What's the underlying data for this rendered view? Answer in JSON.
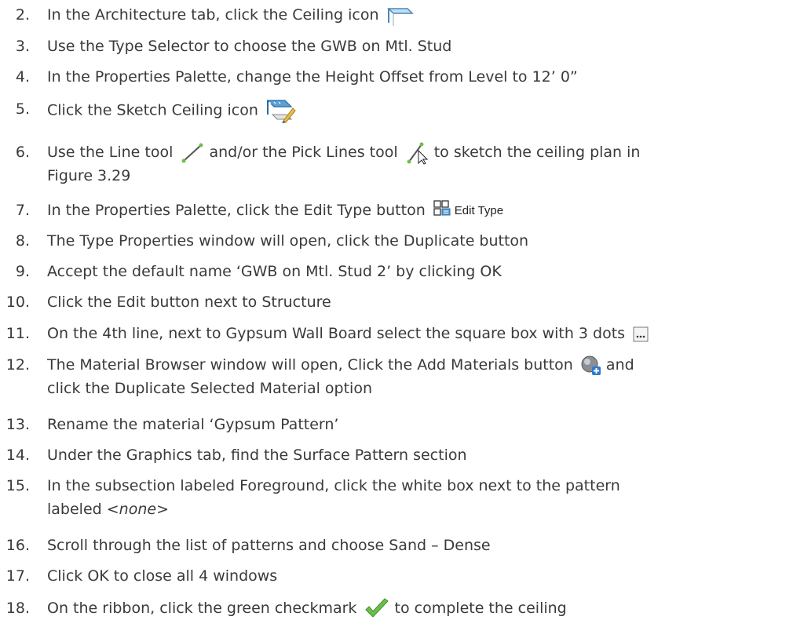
{
  "steps": [
    {
      "num": "2.",
      "text": "In the Architecture tab, click the Ceiling icon",
      "icon": "ceiling-icon"
    },
    {
      "num": "3.",
      "text": "Use the Type Selector to choose the GWB on Mtl. Stud"
    },
    {
      "num": "4.",
      "text": "In the Properties Palette, change the Height Offset from Level to 12’ 0”"
    },
    {
      "num": "5.",
      "text": "Click the Sketch Ceiling icon",
      "icon": "sketch-ceiling-icon"
    },
    {
      "num": "6.",
      "text_a": "Use the Line tool",
      "icon_a": "line-tool-icon",
      "text_b": "and/or the Pick Lines tool",
      "icon_b": "pick-lines-icon",
      "text_c": "to sketch the ceiling plan in",
      "line2": "Figure 3.29"
    },
    {
      "num": "7.",
      "text": "In the Properties Palette, click the Edit Type button",
      "button_label": "Edit Type",
      "icon": "edit-type-icon"
    },
    {
      "num": "8.",
      "text": "The Type Properties window will open, click the Duplicate button"
    },
    {
      "num": "9.",
      "text": "Accept the default name ‘GWB on Mtl. Stud 2’ by clicking OK"
    },
    {
      "num": "10.",
      "text": "Click the Edit button next to Structure"
    },
    {
      "num": "11.",
      "text": "On the 4th line, next to Gypsum Wall Board select the square box with 3 dots",
      "icon": "browse-dots-icon"
    },
    {
      "num": "12.",
      "text_a": "The Material Browser window will open, Click the Add Materials button",
      "icon": "add-material-icon",
      "text_b": "and",
      "line2": "click the Duplicate Selected Material option"
    },
    {
      "num": "13.",
      "text": "Rename the material ‘Gypsum Pattern’"
    },
    {
      "num": "14.",
      "text": "Under the Graphics tab, find the Surface Pattern section"
    },
    {
      "num": "15.",
      "text": "In the subsection labeled Foreground, click the white box next to the pattern",
      "line2_a": "labeled",
      "line2_em": "<none>"
    },
    {
      "num": "16.",
      "text": "Scroll through the list of patterns and choose Sand – Dense"
    },
    {
      "num": "17.",
      "text": "Click OK to close all 4 windows"
    },
    {
      "num": "18.",
      "text_a": "On the ribbon, click the green checkmark",
      "icon": "green-checkmark-icon",
      "text_b": "to complete the ceiling"
    }
  ],
  "colors": {
    "text": "#3a3a3a",
    "accent_blue": "#5aa0d8",
    "check_green": "#6cc04a"
  }
}
